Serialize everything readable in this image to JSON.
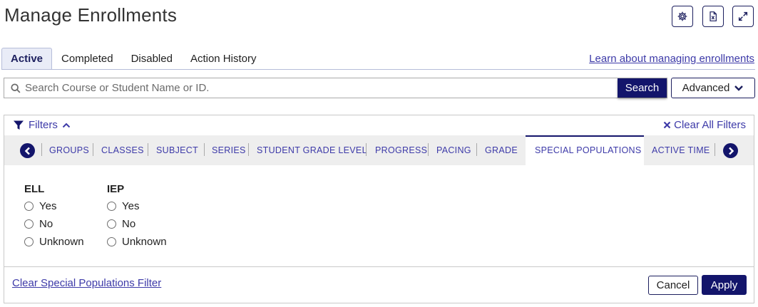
{
  "header": {
    "title": "Manage Enrollments",
    "icons": [
      "gear-icon",
      "excel-export-icon",
      "expand-icon"
    ]
  },
  "tabs": [
    {
      "label": "Active",
      "active": true
    },
    {
      "label": "Completed"
    },
    {
      "label": "Disabled"
    },
    {
      "label": "Action History"
    }
  ],
  "learn_link": "Learn about managing enrollments",
  "search": {
    "placeholder": "Search Course or Student Name or ID.",
    "value": "",
    "button_label": "Search",
    "advanced_label": "Advanced"
  },
  "filters": {
    "label": "Filters",
    "clear_all_label": "Clear All Filters",
    "categories": [
      "GROUPS",
      "CLASSES",
      "SUBJECT",
      "SERIES",
      "STUDENT GRADE LEVEL",
      "PROGRESS",
      "PACING",
      "GRADE",
      "SPECIAL POPULATIONS",
      "ACTIVE TIME"
    ],
    "active_category": "SPECIAL POPULATIONS",
    "groups": [
      {
        "label": "ELL",
        "options": [
          "Yes",
          "No",
          "Unknown"
        ]
      },
      {
        "label": "IEP",
        "options": [
          "Yes",
          "No",
          "Unknown"
        ]
      }
    ],
    "clear_section_label": "Clear Special Populations Filter",
    "cancel_label": "Cancel",
    "apply_label": "Apply"
  },
  "colors": {
    "primary": "#13156b",
    "link": "#3d3aa8",
    "tab_active_bg": "#e9ecf7",
    "strip_bg": "#eeeeee"
  }
}
